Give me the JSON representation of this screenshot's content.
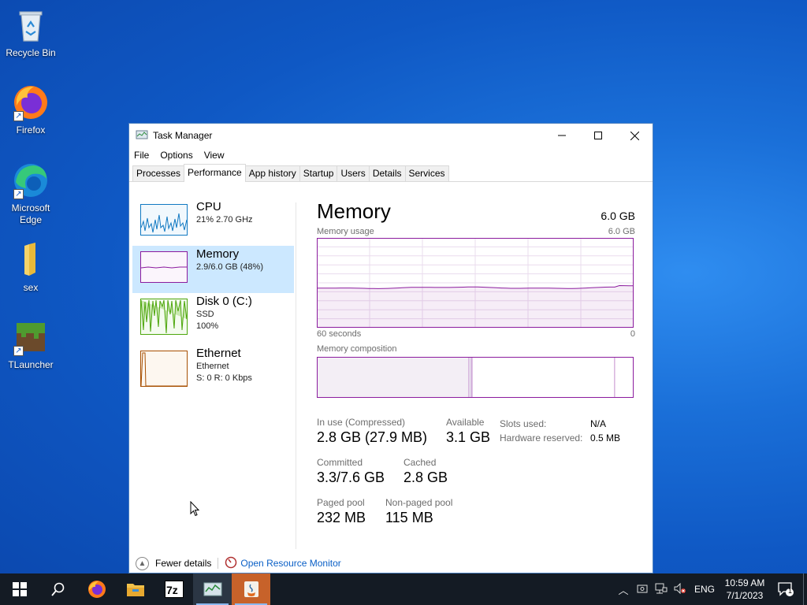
{
  "desktop": {
    "icons": [
      {
        "label": "Recycle Bin",
        "icon": "recycle-bin-icon"
      },
      {
        "label": "Firefox",
        "icon": "firefox-icon"
      },
      {
        "label": "Microsoft Edge",
        "icon": "edge-icon"
      },
      {
        "label": "sex",
        "icon": "folder-icon"
      },
      {
        "label": "TLauncher",
        "icon": "tlauncher-icon"
      }
    ]
  },
  "window": {
    "title": "Task Manager",
    "menu": [
      "File",
      "Options",
      "View"
    ],
    "tabs": [
      "Processes",
      "Performance",
      "App history",
      "Startup",
      "Users",
      "Details",
      "Services"
    ],
    "active_tab": "Performance"
  },
  "sidebar": {
    "items": [
      {
        "name": "CPU",
        "line1": "21%  2.70 GHz",
        "line2": "",
        "color": "#1179c2"
      },
      {
        "name": "Memory",
        "line1": "2.9/6.0 GB (48%)",
        "line2": "",
        "color": "#8b1b9e"
      },
      {
        "name": "Disk 0 (C:)",
        "line1": "SSD",
        "line2": "100%",
        "color": "#4da60c"
      },
      {
        "name": "Ethernet",
        "line1": "Ethernet",
        "line2": "S: 0  R: 0 Kbps",
        "color": "#a74f01"
      }
    ],
    "selected": "Memory"
  },
  "main": {
    "title": "Memory",
    "total": "6.0 GB",
    "usage_label": "Memory usage",
    "usage_max": "6.0 GB",
    "axis_left": "60 seconds",
    "axis_right": "0",
    "composition_label": "Memory composition",
    "in_use_label": "In use (Compressed)",
    "in_use_value": "2.8 GB (27.9 MB)",
    "available_label": "Available",
    "available_value": "3.1 GB",
    "slots_label": "Slots used:",
    "slots_value": "N/A",
    "hw_reserved_label": "Hardware reserved:",
    "hw_reserved_value": "0.5 MB",
    "committed_label": "Committed",
    "committed_value": "3.3/7.6 GB",
    "cached_label": "Cached",
    "cached_value": "2.8 GB",
    "paged_label": "Paged pool",
    "paged_value": "232 MB",
    "nonpaged_label": "Non-paged pool",
    "nonpaged_value": "115 MB"
  },
  "footer": {
    "fewer_details": "Fewer details",
    "resource_monitor": "Open Resource Monitor"
  },
  "memory_usage_fraction": 0.48,
  "memory_composition": {
    "in_use_fraction": 0.48,
    "modified_fraction": 0.01,
    "standby_fraction": 0.45
  },
  "taskbar": {
    "apps": [
      "start-icon",
      "search-icon",
      "firefox-icon",
      "file-explorer-icon",
      "7zip-icon",
      "task-manager-icon",
      "java-icon"
    ],
    "lang": "ENG",
    "time": "10:59 AM",
    "date": "7/1/2023",
    "notification_count": "1"
  },
  "colors": {
    "memory": "#8b1b9e",
    "cpu": "#1179c2",
    "disk": "#4da60c",
    "ethernet": "#a74f01",
    "selection": "#cce8ff",
    "taskbar": "#141b24"
  }
}
